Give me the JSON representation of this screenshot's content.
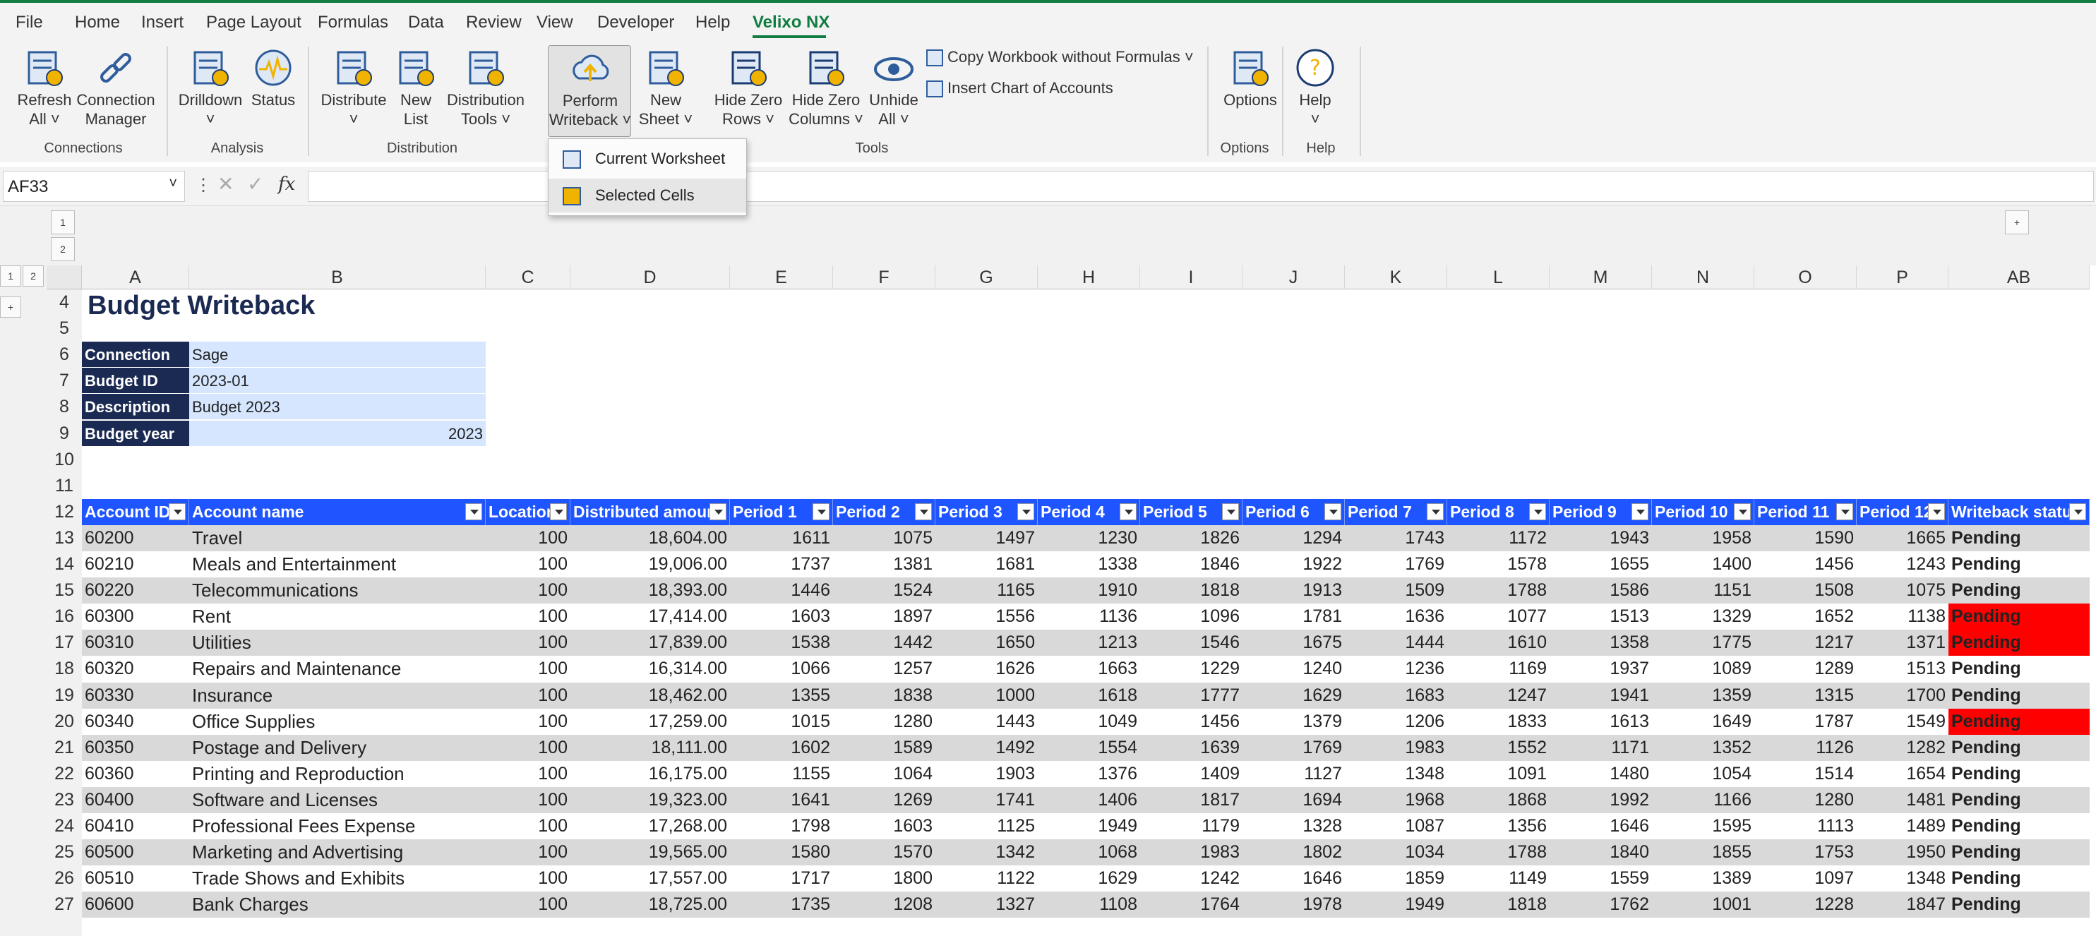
{
  "menu": {
    "tabs": [
      "File",
      "Home",
      "Insert",
      "Page Layout",
      "Formulas",
      "Data",
      "Review",
      "View",
      "Developer",
      "Help",
      "Velixo NX"
    ],
    "active": "Velixo NX"
  },
  "ribbon": {
    "buttons": [
      {
        "id": "refresh",
        "label": "Refresh\nAll ˅"
      },
      {
        "id": "connection-manager",
        "label": "Connection\nManager"
      },
      {
        "id": "drilldown",
        "label": "Drilldown\n˅"
      },
      {
        "id": "status",
        "label": "Status"
      },
      {
        "id": "distribute",
        "label": "Distribute\n˅"
      },
      {
        "id": "new-list",
        "label": "New\nList"
      },
      {
        "id": "distribution-tools",
        "label": "Distribution\nTools ˅"
      },
      {
        "id": "perform-writeback",
        "label": "Perform\nWriteback ˅"
      },
      {
        "id": "new-sheet",
        "label": "New\nSheet ˅"
      },
      {
        "id": "hide-zero-rows",
        "label": "Hide Zero\nRows ˅"
      },
      {
        "id": "hide-zero-columns",
        "label": "Hide Zero\nColumns ˅"
      },
      {
        "id": "unhide-all",
        "label": "Unhide\nAll ˅"
      },
      {
        "id": "options",
        "label": "Options"
      },
      {
        "id": "help",
        "label": "Help\n˅"
      }
    ],
    "small": {
      "copy": "Copy Workbook without Formulas ˅",
      "insert_chart": "Insert Chart of Accounts"
    },
    "groups": {
      "connections": "Connections",
      "analysis": "Analysis",
      "distribution": "Distribution",
      "tools": "Tools",
      "options": "Options",
      "help": "Help"
    }
  },
  "dropdown": {
    "items": [
      "Current Worksheet",
      "Selected Cells"
    ]
  },
  "formula_bar": {
    "name_box": "AF33",
    "fx": "fx",
    "value": ""
  },
  "outline": {
    "levels": [
      "1",
      "2"
    ],
    "plus": "+"
  },
  "columns": [
    "A",
    "B",
    "C",
    "D",
    "E",
    "F",
    "G",
    "H",
    "I",
    "J",
    "K",
    "L",
    "M",
    "N",
    "O",
    "P",
    "AB"
  ],
  "sheet": {
    "title": "Budget Writeback",
    "info": [
      {
        "label": "Connection",
        "value": "Sage"
      },
      {
        "label": "Budget ID",
        "value": "2023-01"
      },
      {
        "label": "Description",
        "value": "Budget 2023"
      },
      {
        "label": "Budget year",
        "value": "2023"
      }
    ],
    "row_numbers": [
      "4",
      "5",
      "6",
      "7",
      "8",
      "9",
      "10",
      "11",
      "12",
      "13",
      "14",
      "15",
      "16",
      "17",
      "18",
      "19",
      "20",
      "21",
      "22",
      "23",
      "24",
      "25",
      "26",
      "27"
    ],
    "headers": [
      "Account ID",
      "Account name",
      "Location",
      "Distributed amount",
      "Period 1",
      "Period 2",
      "Period 3",
      "Period 4",
      "Period 5",
      "Period 6",
      "Period 7",
      "Period 8",
      "Period 9",
      "Period 10",
      "Period 11",
      "Period 12",
      "Writeback status"
    ],
    "rows": [
      [
        "60200",
        "Travel",
        "100",
        "18,604.00",
        "1611",
        "1075",
        "1497",
        "1230",
        "1826",
        "1294",
        "1743",
        "1172",
        "1943",
        "1958",
        "1590",
        "1665",
        "Pending"
      ],
      [
        "60210",
        "Meals and Entertainment",
        "100",
        "19,006.00",
        "1737",
        "1381",
        "1681",
        "1338",
        "1846",
        "1922",
        "1769",
        "1578",
        "1655",
        "1400",
        "1456",
        "1243",
        "Pending"
      ],
      [
        "60220",
        "Telecommunications",
        "100",
        "18,393.00",
        "1446",
        "1524",
        "1165",
        "1910",
        "1818",
        "1913",
        "1509",
        "1788",
        "1586",
        "1151",
        "1508",
        "1075",
        "Pending"
      ],
      [
        "60300",
        "Rent",
        "100",
        "17,414.00",
        "1603",
        "1897",
        "1556",
        "1136",
        "1096",
        "1781",
        "1636",
        "1077",
        "1513",
        "1329",
        "1652",
        "1138",
        "Pending"
      ],
      [
        "60310",
        "Utilities",
        "100",
        "17,839.00",
        "1538",
        "1442",
        "1650",
        "1213",
        "1546",
        "1675",
        "1444",
        "1610",
        "1358",
        "1775",
        "1217",
        "1371",
        "Pending"
      ],
      [
        "60320",
        "Repairs and Maintenance",
        "100",
        "16,314.00",
        "1066",
        "1257",
        "1626",
        "1663",
        "1229",
        "1240",
        "1236",
        "1169",
        "1937",
        "1089",
        "1289",
        "1513",
        "Pending"
      ],
      [
        "60330",
        "Insurance",
        "100",
        "18,462.00",
        "1355",
        "1838",
        "1000",
        "1618",
        "1777",
        "1629",
        "1683",
        "1247",
        "1941",
        "1359",
        "1315",
        "1700",
        "Pending"
      ],
      [
        "60340",
        "Office Supplies",
        "100",
        "17,259.00",
        "1015",
        "1280",
        "1443",
        "1049",
        "1456",
        "1379",
        "1206",
        "1833",
        "1613",
        "1649",
        "1787",
        "1549",
        "Pending"
      ],
      [
        "60350",
        "Postage and Delivery",
        "100",
        "18,111.00",
        "1602",
        "1589",
        "1492",
        "1554",
        "1639",
        "1769",
        "1983",
        "1552",
        "1171",
        "1352",
        "1126",
        "1282",
        "Pending"
      ],
      [
        "60360",
        "Printing and Reproduction",
        "100",
        "16,175.00",
        "1155",
        "1064",
        "1903",
        "1376",
        "1409",
        "1127",
        "1348",
        "1091",
        "1480",
        "1054",
        "1514",
        "1654",
        "Pending"
      ],
      [
        "60400",
        "Software and Licenses",
        "100",
        "19,323.00",
        "1641",
        "1269",
        "1741",
        "1406",
        "1817",
        "1694",
        "1968",
        "1868",
        "1992",
        "1166",
        "1280",
        "1481",
        "Pending"
      ],
      [
        "60410",
        "Professional Fees Expense",
        "100",
        "17,268.00",
        "1798",
        "1603",
        "1125",
        "1949",
        "1179",
        "1328",
        "1087",
        "1356",
        "1646",
        "1595",
        "1113",
        "1489",
        "Pending"
      ],
      [
        "60500",
        "Marketing and Advertising",
        "100",
        "19,565.00",
        "1580",
        "1570",
        "1342",
        "1068",
        "1983",
        "1802",
        "1034",
        "1788",
        "1840",
        "1855",
        "1753",
        "1950",
        "Pending"
      ],
      [
        "60510",
        "Trade Shows and Exhibits",
        "100",
        "17,557.00",
        "1717",
        "1800",
        "1122",
        "1629",
        "1242",
        "1646",
        "1859",
        "1149",
        "1559",
        "1389",
        "1097",
        "1348",
        "Pending"
      ],
      [
        "60600",
        "Bank Charges",
        "100",
        "18,725.00",
        "1735",
        "1208",
        "1327",
        "1108",
        "1764",
        "1978",
        "1949",
        "1818",
        "1762",
        "1001",
        "1228",
        "1847",
        "Pending"
      ]
    ],
    "red_status_rows": [
      3,
      4,
      7
    ],
    "colors": {
      "header": "#1f55ff",
      "label": "#1b2a52",
      "value": "#d6e6ff",
      "band": "#d9d9d9",
      "alert": "#ff0000",
      "title": "#1b2a52"
    }
  }
}
